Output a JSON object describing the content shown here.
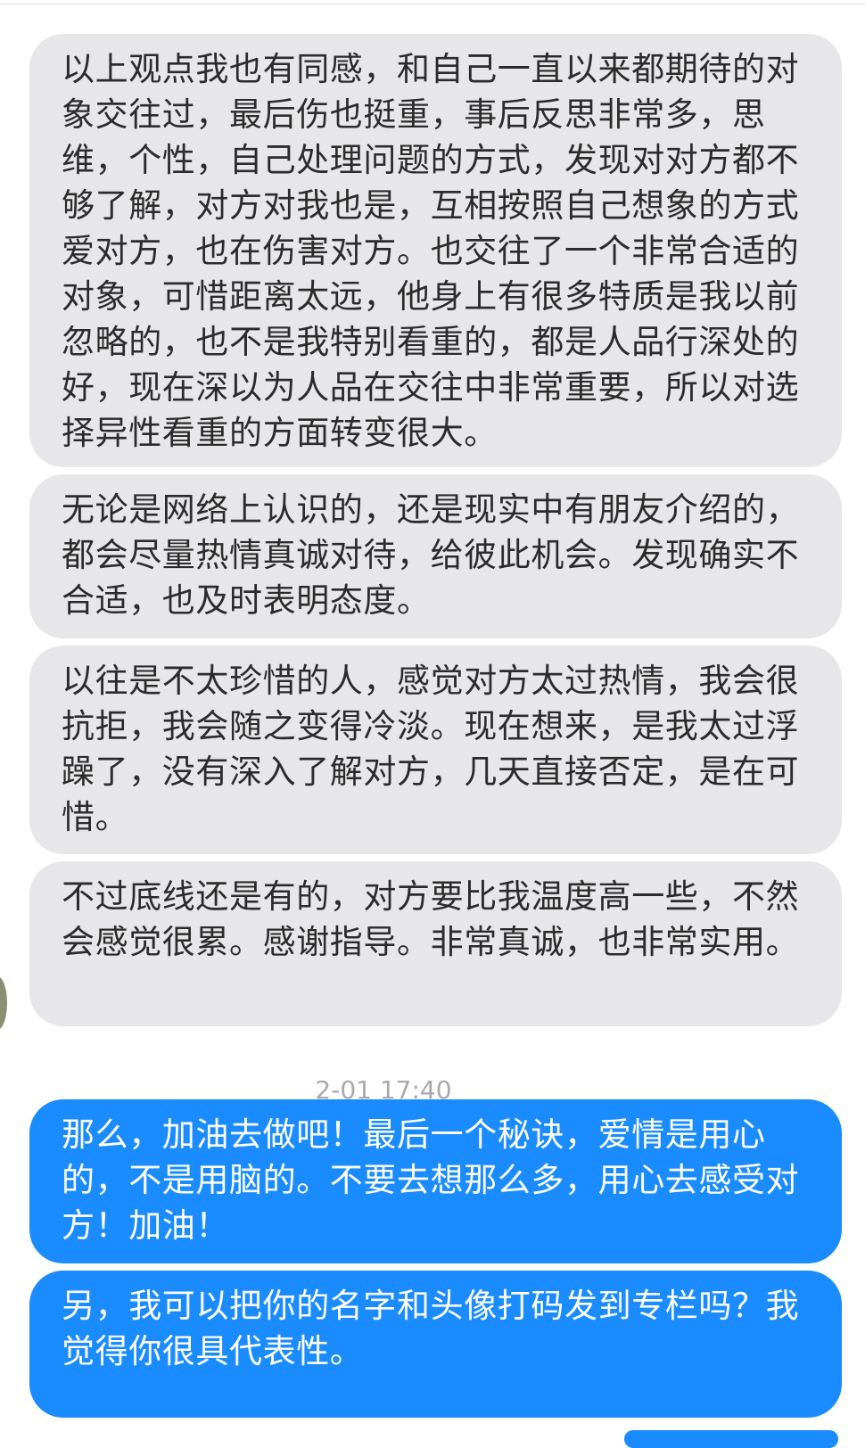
{
  "colors": {
    "received_bubble": "#e7e7e9",
    "sent_bubble": "#1a8cff",
    "timestamp_text": "#a9a9a9"
  },
  "messages": [
    {
      "direction": "received",
      "text": "以上观点我也有同感，和自己一直以来都期待的对象交往过，最后伤也挺重，事后反思非常多，思维，个性，自己处理问题的方式，发现对对方都不够了解，对方对我也是，互相按照自己想象的方式爱对方，也在伤害对方。也交往了一个非常合适的对象，可惜距离太远，他身上有很多特质是我以前忽略的，也不是我特别看重的，都是人品行深处的好，现在深以为人品在交往中非常重要，所以对选择异性看重的方面转变很大。"
    },
    {
      "direction": "received",
      "text": "无论是网络上认识的，还是现实中有朋友介绍的，都会尽量热情真诚对待，给彼此机会。发现确实不合适，也及时表明态度。"
    },
    {
      "direction": "received",
      "text": "以往是不太珍惜的人，感觉对方太过热情，我会很抗拒，我会随之变得冷淡。现在想来，是我太过浮躁了，没有深入了解对方，几天直接否定，是在可惜。"
    },
    {
      "direction": "received",
      "text": "不过底线还是有的，对方要比我温度高一些，不然会感觉很累。感谢指导。非常真诚，也非常实用。"
    },
    {
      "direction": "sent",
      "text": "那么，加油去做吧！最后一个秘诀，爱情是用心的，不是用脑的。不要去想那么多，用心去感受对方！加油！"
    },
    {
      "direction": "sent",
      "text": "另，我可以把你的名字和头像打码发到专栏吗？我觉得你很具代表性。"
    }
  ],
  "timestamp": "2-01 17:40"
}
